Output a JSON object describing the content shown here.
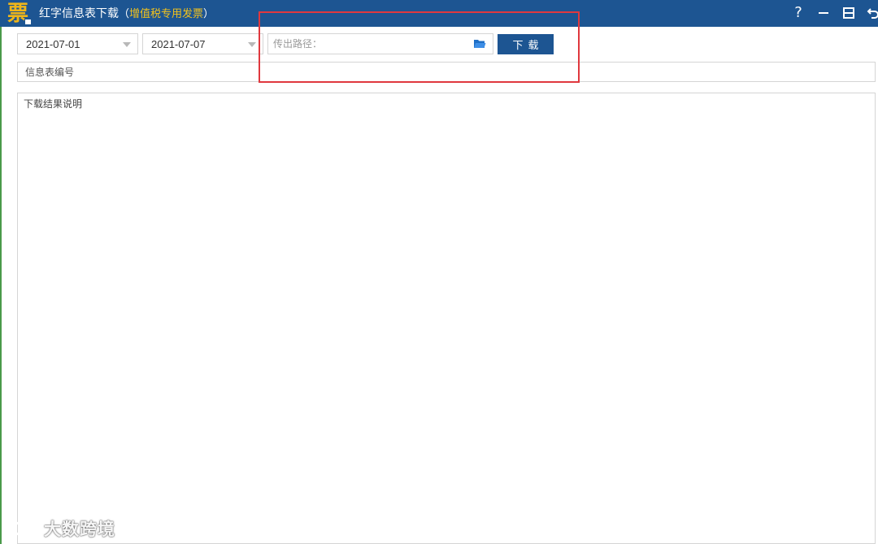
{
  "titlebar": {
    "logo_glyph": "票",
    "title": "红字信息表下载",
    "subtitle_open": "（",
    "subtitle": "增值税专用发票",
    "subtitle_close": "）",
    "help_label": "?",
    "minimize_icon": "minimize-icon",
    "restore_icon": "restore-icon",
    "back_icon": "back-arrow-icon",
    "color": "#1d5592",
    "subtitle_color": "#f2c21c"
  },
  "filters": {
    "start_date": "2021-07-01",
    "end_date": "2021-07-07",
    "path_placeholder": "传出路径：",
    "path_value": "",
    "folder_icon": "folder-open-icon",
    "download_label": "下载"
  },
  "info_number": {
    "placeholder": "信息表编号",
    "value": ""
  },
  "result": {
    "label": "下载结果说明"
  },
  "watermark": {
    "text": "大数跨境"
  },
  "colors": {
    "highlight_box": "#e0383e",
    "button": "#1d5592"
  }
}
